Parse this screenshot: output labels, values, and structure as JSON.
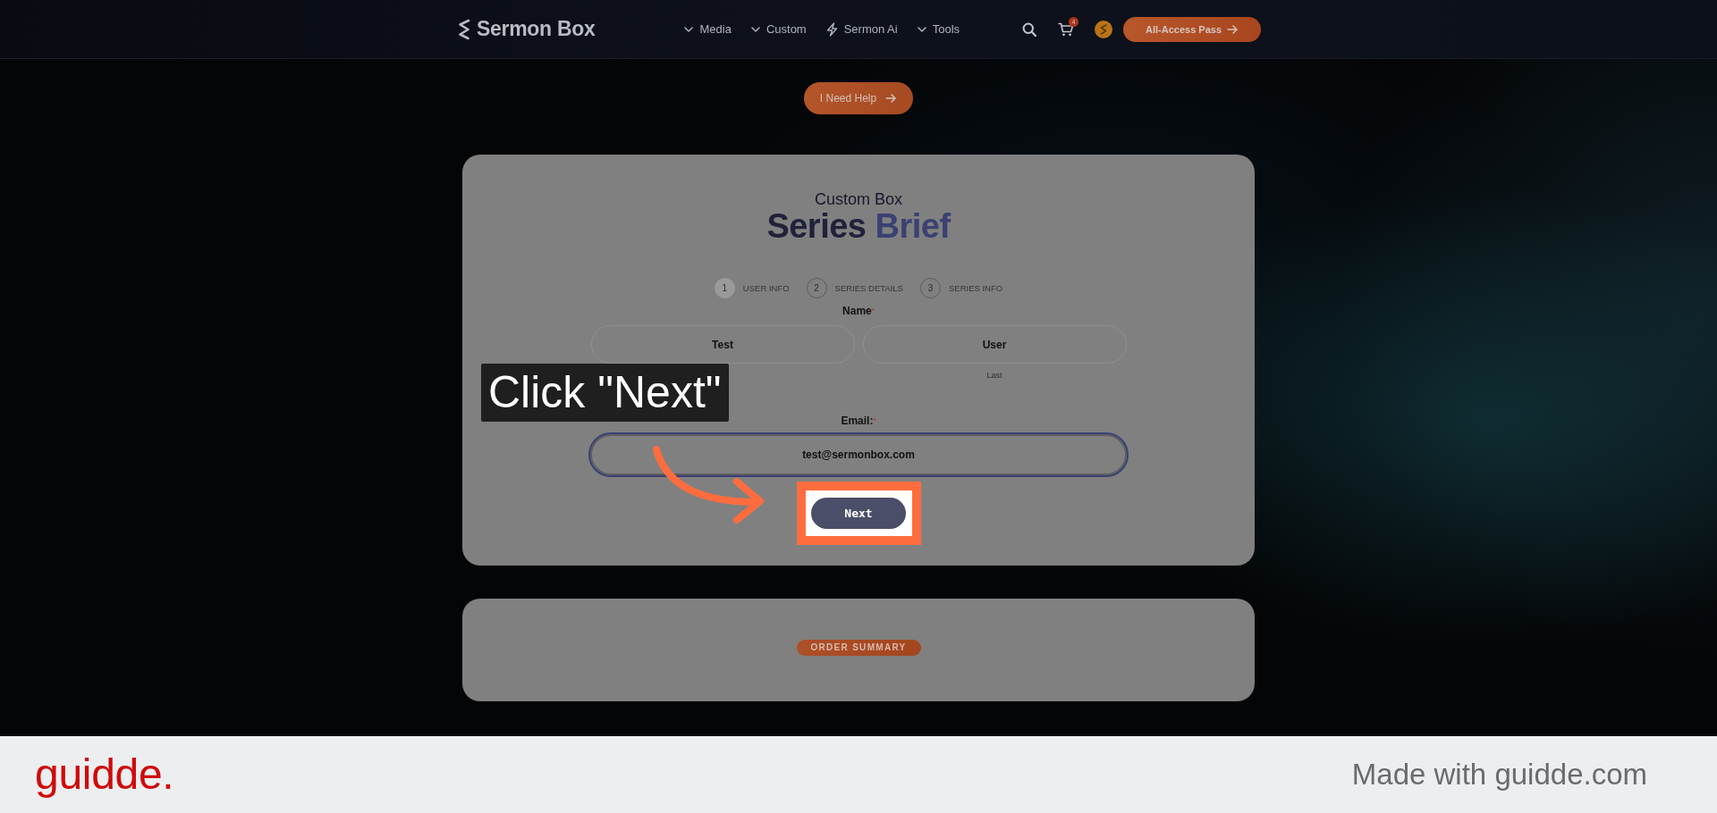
{
  "header": {
    "logo": "Sermon Box",
    "nav": [
      {
        "label": "Media",
        "kind": "menu"
      },
      {
        "label": "Custom",
        "kind": "menu"
      },
      {
        "label": "Sermon Ai",
        "kind": "ai"
      },
      {
        "label": "Tools",
        "kind": "menu"
      }
    ],
    "cart_count": "4",
    "cta": "All-Access Pass"
  },
  "help_button": "I Need Help",
  "form_card": {
    "eyebrow": "Custom Box",
    "title": [
      {
        "text": "Series",
        "accent": false
      },
      {
        "text": "Brief",
        "accent": true
      }
    ],
    "steps": [
      {
        "number": "1",
        "label": "USER INFO",
        "selected": true
      },
      {
        "number": "2",
        "label": "SERIES DETAILS",
        "selected": false
      },
      {
        "number": "3",
        "label": "SERIES INFO",
        "selected": false
      }
    ],
    "name": {
      "label": "Name",
      "marker": "*",
      "fields": [
        {
          "value": "Test"
        },
        {
          "value": "User",
          "sublabel": "Last"
        }
      ]
    },
    "email": {
      "label": "Email:",
      "marker": "*",
      "value": "test@sermonbox.com",
      "focused": true
    },
    "next_button": "Next"
  },
  "order_card": {
    "badge": "ORDER SUMMARY"
  },
  "callout": {
    "text": "Click \"Next\""
  },
  "footer": {
    "logo": "guidde.",
    "credit": "Made with guidde.com"
  }
}
